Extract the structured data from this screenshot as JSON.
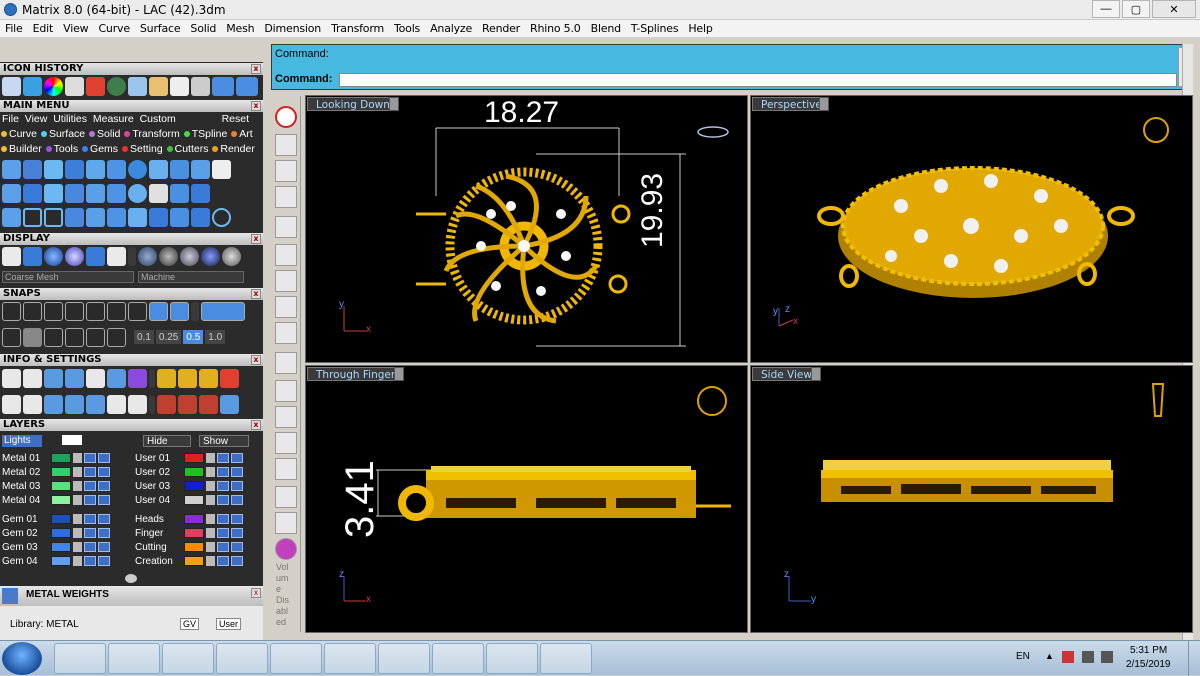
{
  "window": {
    "title": "Matrix 8.0 (64-bit) - LAC (42).3dm",
    "min": "—",
    "max": "▢",
    "close": "✕"
  },
  "menu": [
    "File",
    "Edit",
    "View",
    "Curve",
    "Surface",
    "Solid",
    "Mesh",
    "Dimension",
    "Transform",
    "Tools",
    "Analyze",
    "Render",
    "Rhino 5.0",
    "Blend",
    "T-Splines",
    "Help"
  ],
  "panels": {
    "icon_history": "ICON HISTORY",
    "main_menu": "MAIN MENU",
    "main_menu_items": [
      "File",
      "View",
      "Utilities",
      "Measure",
      "Custom"
    ],
    "reset": "Reset",
    "row1": [
      "Curve",
      "Surface",
      "Solid",
      "Transform",
      "TSpline",
      "Art"
    ],
    "row2": [
      "Builder",
      "Tools",
      "Gems",
      "Setting",
      "Cutters",
      "Render"
    ],
    "display": "DISPLAY",
    "display_select1": "Coarse Mesh",
    "display_select2": "Machine",
    "snaps": "SNAPS",
    "snap_values": [
      "0.1",
      "0.25",
      "0.5",
      "1.0"
    ],
    "info": "INFO & SETTINGS",
    "layers": "LAYERS",
    "lights": "Lights",
    "hide": "Hide",
    "show": "Show",
    "metal_weights": "METAL WEIGHTS",
    "library": "Library: METAL",
    "gv": "GV",
    "user": "User"
  },
  "layers_left": [
    {
      "name": "Metal 01",
      "color": "#1aa35a"
    },
    {
      "name": "Metal 02",
      "color": "#2fcf6c"
    },
    {
      "name": "Metal 03",
      "color": "#58e27a"
    },
    {
      "name": "Metal 04",
      "color": "#8ff0a0"
    },
    {
      "name": "Gem 01",
      "color": "#1f4fb8"
    },
    {
      "name": "Gem 02",
      "color": "#2f6fdc"
    },
    {
      "name": "Gem 03",
      "color": "#3f86e8"
    },
    {
      "name": "Gem 04",
      "color": "#5fa0f0"
    }
  ],
  "layers_right": [
    {
      "name": "User 01",
      "color": "#e02020"
    },
    {
      "name": "User 02",
      "color": "#20c020"
    },
    {
      "name": "User 03",
      "color": "#1020d0"
    },
    {
      "name": "User 04",
      "color": "#d0d0d0"
    },
    {
      "name": "Heads",
      "color": "#8a2be2"
    },
    {
      "name": "Finger",
      "color": "#e04060"
    },
    {
      "name": "Cutting",
      "color": "#ff8c00"
    },
    {
      "name": "Creation",
      "color": "#f0a020"
    }
  ],
  "command": {
    "line1": "Command:",
    "line2": "Command:"
  },
  "vtoolbar_text": [
    "Vol",
    "um",
    "e",
    "Dis",
    "abl",
    "ed"
  ],
  "viewports": {
    "top": {
      "label": "Looking Down",
      "dim_w": "18.27",
      "dim_h": "19.93"
    },
    "persp": {
      "label": "Perspective"
    },
    "front": {
      "label": "Through Finger",
      "dim": "3.41"
    },
    "side": {
      "label": "Side View"
    }
  },
  "axes": {
    "x": "x",
    "y": "y",
    "z": "z"
  },
  "taskbar": {
    "lang": "EN",
    "time": "5:31 PM",
    "date": "2/15/2019"
  },
  "colors": {
    "gold": "#f0b800",
    "cmd_bg": "#47b8e0",
    "label_fg": "#aad8ff"
  }
}
